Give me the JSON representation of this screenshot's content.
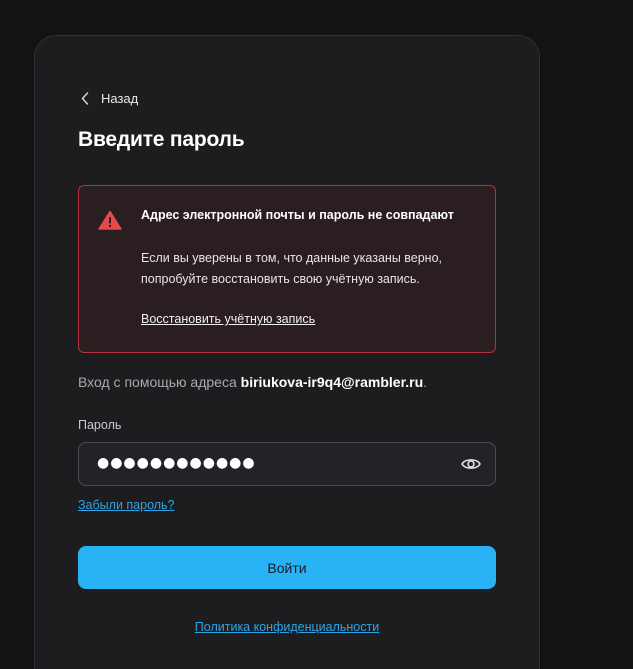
{
  "nav": {
    "back_label": "Назад",
    "back_icon": "chevron-left-icon"
  },
  "page": {
    "title": "Введите пароль"
  },
  "alert": {
    "icon": "warning-triangle-icon",
    "title": "Адрес электронной почты и пароль не совпадают",
    "text": "Если вы уверены в том, что данные указаны верно, попробуйте восстановить свою учётную запись.",
    "link_label": "Восстановить учётную запись",
    "border_color": "#b2323e",
    "icon_color": "#e5484d"
  },
  "login": {
    "prefix": "Вход с помощью адреса ",
    "email": "biriukova-ir9q4@rambler.ru",
    "suffix": "."
  },
  "password": {
    "label": "Пароль",
    "value": "●●●●●●●●●●●●",
    "toggle_icon": "eye-icon"
  },
  "forgot_label": "Забыли пароль?",
  "submit_label": "Войти",
  "privacy_label": "Политика конфиденциальности",
  "colors": {
    "accent": "#27b3f6",
    "link": "#2ba5e8",
    "card_bg": "#1d1d20"
  }
}
